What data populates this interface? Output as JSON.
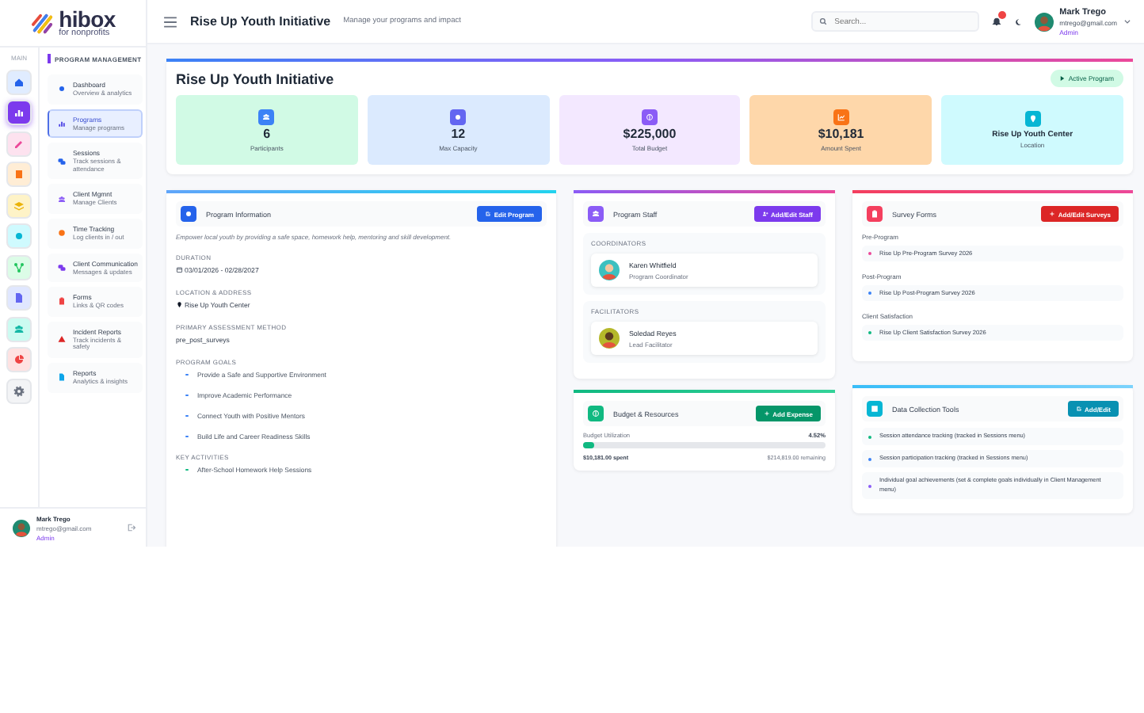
{
  "sidebar": {
    "logo": {
      "name": "hibox",
      "tagline": "for nonprofits"
    },
    "rail_label": "MAIN",
    "rail": [
      {
        "color": "#2563eb",
        "selected": false
      },
      {
        "color": "#7c3aed",
        "selected": true
      },
      {
        "color": "#ec4899",
        "selected": false
      },
      {
        "color": "#f97316",
        "selected": false
      },
      {
        "color": "#eab308",
        "selected": false
      },
      {
        "color": "#06b6d4",
        "selected": false
      },
      {
        "color": "#22c55e",
        "selected": false
      },
      {
        "color": "#6366f1",
        "selected": false
      },
      {
        "color": "#14b8a6",
        "selected": false
      },
      {
        "color": "#ef4444",
        "selected": false
      },
      {
        "color": "#6b7280",
        "selected": false
      }
    ],
    "section_title": "PROGRAM MANAGEMENT",
    "nav": [
      {
        "title": "Dashboard",
        "subtitle": "Overview & analytics",
        "color": "#2563eb",
        "selected": false
      },
      {
        "title": "Programs",
        "subtitle": "Manage programs",
        "color": "#4f46e5",
        "selected": true
      },
      {
        "title": "Sessions",
        "subtitle": "Track sessions & attendance",
        "color": "#2563eb",
        "selected": false
      },
      {
        "title": "Client Mgmnt",
        "subtitle": "Manage Clients",
        "color": "#8b5cf6",
        "selected": false
      },
      {
        "title": "Time Tracking",
        "subtitle": "Log clients in / out",
        "color": "#f97316",
        "selected": false
      },
      {
        "title": "Client Communication",
        "subtitle": "Messages & updates",
        "color": "#7c3aed",
        "selected": false
      },
      {
        "title": "Forms",
        "subtitle": "Links & QR codes",
        "color": "#ef4444",
        "selected": false
      },
      {
        "title": "Incident Reports",
        "subtitle": "Track incidents & safety",
        "color": "#dc2626",
        "selected": false
      },
      {
        "title": "Reports",
        "subtitle": "Analytics & insights",
        "color": "#0ea5e9",
        "selected": false
      }
    ],
    "user": {
      "name": "Mark Trego",
      "email": "mtrego@gmail.com",
      "role": "Admin"
    }
  },
  "topbar": {
    "title": "Rise Up Youth Initiative",
    "subtitle": "Manage your programs and impact",
    "search": {
      "placeholder": "Search..."
    },
    "user": {
      "name": "Mark Trego",
      "email": "mtrego@gmail.com",
      "role": "Admin"
    }
  },
  "header": {
    "title": "Rise Up Youth Initiative",
    "status": "Active Program",
    "stats": [
      {
        "value": "6",
        "label": "Participants"
      },
      {
        "value": "12",
        "label": "Max Capacity"
      },
      {
        "value": "$225,000",
        "label": "Total Budget"
      },
      {
        "value": "$10,181",
        "label": "Amount Spent"
      },
      {
        "value": "Rise Up Youth Center",
        "label": "Location"
      }
    ]
  },
  "program_info": {
    "title": "Program Information",
    "button": "Edit Program",
    "description": "Empower local youth by providing a safe space, homework help, mentoring and skill development.",
    "fields": [
      {
        "label": "DURATION",
        "value": "03/01/2026 - 02/28/2027",
        "kind": "date"
      },
      {
        "label": "LOCATION & ADDRESS",
        "value": "Rise Up Youth Center",
        "kind": "location"
      },
      {
        "label": "PRIMARY ASSESSMENT METHOD",
        "value": "pre_post_surveys",
        "kind": "plain"
      }
    ],
    "goals_label": "PROGRAM GOALS",
    "goals": [
      "Provide a Safe and Supportive Environment",
      "Improve Academic Performance",
      "Connect Youth with Positive Mentors",
      "Build Life and Career Readiness Skills"
    ],
    "activities_label": "KEY ACTIVITIES",
    "activities": [
      "After-School Homework Help Sessions"
    ]
  },
  "staff": {
    "title": "Program Staff",
    "button": "Add/Edit Staff",
    "groups": [
      {
        "label": "COORDINATORS",
        "people": [
          {
            "name": "Karen Whitfield",
            "role": "Program Coordinator"
          }
        ]
      },
      {
        "label": "FACILITATORS",
        "people": [
          {
            "name": "Soledad Reyes",
            "role": "Lead Facilitator"
          }
        ]
      }
    ]
  },
  "budget": {
    "title": "Budget & Resources",
    "button": "Add Expense",
    "label": "Budget Utilization",
    "percent": "4.52%",
    "level": 0.0452,
    "spent": "$10,181.00 spent",
    "remaining": "$214,819.00 remaining"
  },
  "surveys": {
    "title": "Survey Forms",
    "button": "Add/Edit Surveys",
    "groups": [
      {
        "label": "Pre-Program",
        "items": [
          {
            "name": "Rise Up Pre-Program Survey 2026",
            "color": "#ec4899"
          }
        ]
      },
      {
        "label": "Post-Program",
        "items": [
          {
            "name": "Rise Up Post-Program Survey 2026",
            "color": "#3b82f6"
          }
        ]
      },
      {
        "label": "Client Satisfaction",
        "items": [
          {
            "name": "Rise Up Client Satisfaction Survey 2026",
            "color": "#10b981"
          }
        ]
      }
    ]
  },
  "tools": {
    "title": "Data Collection Tools",
    "button": "Add/Edit",
    "items": [
      {
        "text": "Session attendance tracking (tracked in Sessions menu)",
        "color": "#10b981"
      },
      {
        "text": "Session participation tracking (tracked in Sessions menu)",
        "color": "#3b82f6"
      },
      {
        "text": "Individual goal achievements (set & complete goals individually in Client Management menu)",
        "color": "#8b5cf6"
      }
    ]
  }
}
